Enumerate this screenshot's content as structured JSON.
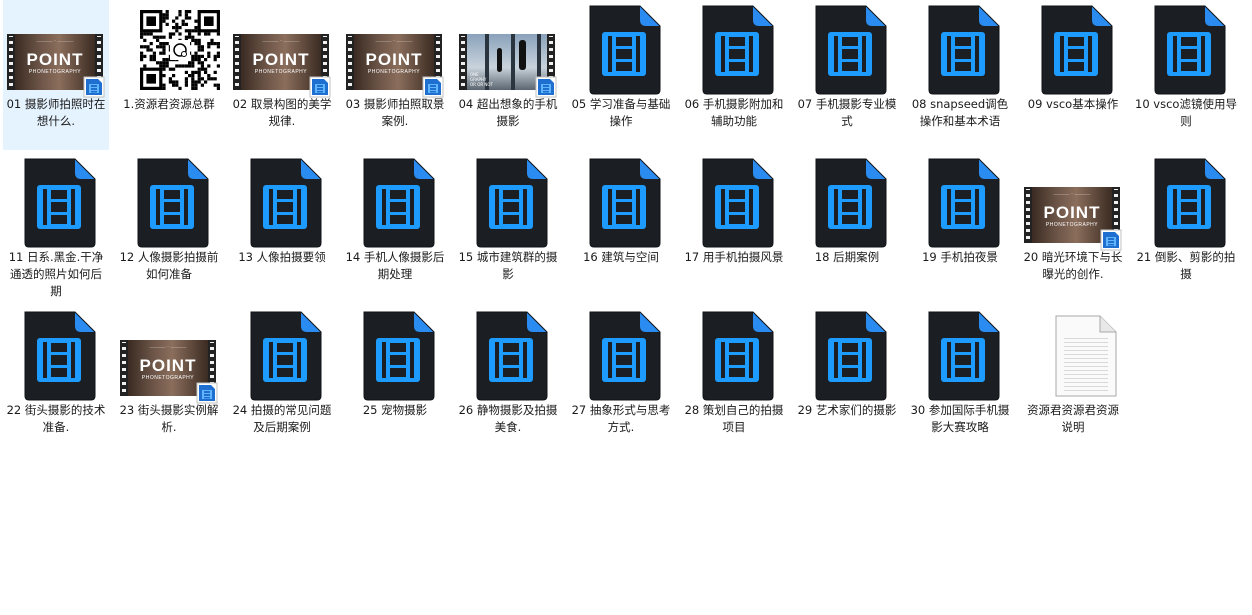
{
  "files": [
    {
      "label": "01 摄影师拍照时在想什么.",
      "type": "film-point",
      "selected": true
    },
    {
      "label": "1.资源君资源总群",
      "type": "qr"
    },
    {
      "label": "02 取景构图的美学规律.",
      "type": "film-point"
    },
    {
      "label": "03 摄影师拍照取景案例.",
      "type": "film-point"
    },
    {
      "label": "04 超出想象的手机摄影",
      "type": "film-city"
    },
    {
      "label": "05 学习准备与基础操作",
      "type": "video"
    },
    {
      "label": "06 手机摄影附加和辅助功能",
      "type": "video"
    },
    {
      "label": "07 手机摄影专业模式",
      "type": "video"
    },
    {
      "label": "08 snapseed调色操作和基本术语",
      "type": "video"
    },
    {
      "label": "09 vsco基本操作",
      "type": "video"
    },
    {
      "label": "10 vsco滤镜使用导则",
      "type": "video"
    },
    {
      "label": "11 日系.黑金.干净通透的照片如何后期",
      "type": "video"
    },
    {
      "label": "12 人像摄影拍摄前如何准备",
      "type": "video"
    },
    {
      "label": "13 人像拍摄要领",
      "type": "video"
    },
    {
      "label": "14 手机人像摄影后期处理",
      "type": "video"
    },
    {
      "label": "15 城市建筑群的摄影",
      "type": "video"
    },
    {
      "label": "16 建筑与空间",
      "type": "video"
    },
    {
      "label": "17 用手机拍摄风景",
      "type": "video"
    },
    {
      "label": "18 后期案例",
      "type": "video"
    },
    {
      "label": "19 手机拍夜景",
      "type": "video"
    },
    {
      "label": "20 暗光环境下与长曝光的创作.",
      "type": "film-point"
    },
    {
      "label": "21 倒影、剪影的拍摄",
      "type": "video"
    },
    {
      "label": "22 街头摄影的技术准备.",
      "type": "video"
    },
    {
      "label": "23 街头摄影实例解析.",
      "type": "film-point"
    },
    {
      "label": "24 拍摄的常见问题及后期案例",
      "type": "video"
    },
    {
      "label": "25 宠物摄影",
      "type": "video"
    },
    {
      "label": "26 静物摄影及拍摄美食.",
      "type": "video"
    },
    {
      "label": "27 抽象形式与思考方式.",
      "type": "video"
    },
    {
      "label": "28 策划自己的拍摄项目",
      "type": "video"
    },
    {
      "label": "29 艺术家们的摄影",
      "type": "video"
    },
    {
      "label": "30 参加国际手机摄影大赛攻略",
      "type": "video"
    },
    {
      "label": "资源君资源君资源说明",
      "type": "doc"
    }
  ],
  "thumb_text": {
    "point_title": "POINT",
    "point_sub": "PHONETOGRAPHY",
    "city_text": "ONE\nGRAPHY\nOR OR NOT"
  },
  "colors": {
    "selection": "#cce8ff",
    "video_body": "#1c2228",
    "video_accent": "#1e90ff",
    "label_text": "#1a1a1a"
  }
}
